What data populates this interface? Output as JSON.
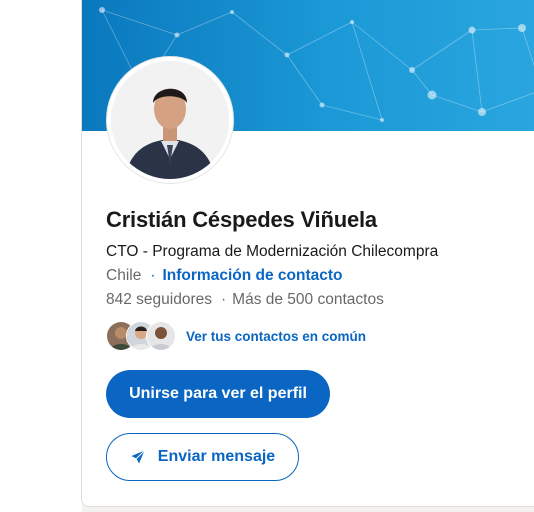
{
  "profile": {
    "name": "Cristián Céspedes Viñuela",
    "headline": "CTO - Programa de Modernización Chilecompra",
    "location": "Chile",
    "separator_dot": "·",
    "contact_info_link": "Información de contacto",
    "followers": "842 seguidores",
    "stats_separator": "·",
    "connections": "Más de 500 contactos",
    "mutual_link": "Ver tus contactos en común"
  },
  "actions": {
    "join_label": "Unirse para ver el perfil",
    "message_label": "Enviar mensaje"
  },
  "icons": {
    "message": "send-icon",
    "avatar": "profile-photo",
    "mutual": "mutual-connection-avatars"
  },
  "colors": {
    "brand_blue": "#0a66c2",
    "banner_blue": "#1c9ad7",
    "text_primary": "#191919",
    "text_secondary": "#666666"
  }
}
